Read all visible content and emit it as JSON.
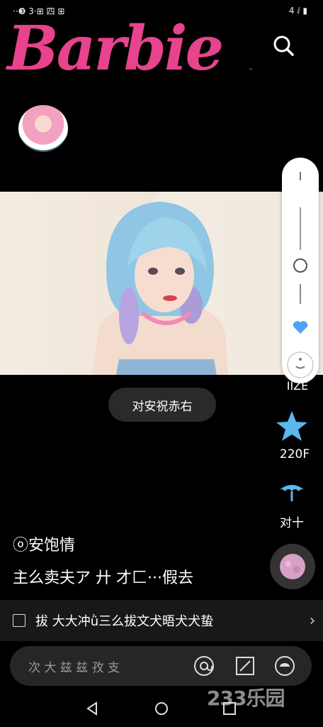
{
  "status_bar": {
    "left": "··❸ 3·⊞ 四 ⊞",
    "right": "4 ⅈ ▮"
  },
  "brand": {
    "logo_text": "Barbie",
    "tm": "™",
    "color": "#e8438d"
  },
  "side_actions": {
    "like_count": "IIZE",
    "star_count": "220F",
    "umbrella_label": "对十"
  },
  "tag_pill": "对安祝赤右",
  "caption": {
    "line1": "ⓞ安饱情",
    "line2": "主么卖夫ア 廾 才匚···假去"
  },
  "hint_bar": {
    "text": "拔 大大冲ǜ三么拔文犬晤犬犬蛰"
  },
  "comment_bar": {
    "placeholder": "次 大 兹 兹 孜 支"
  },
  "watermark": "233乐园",
  "colors": {
    "accent": "#e8438d",
    "heart": "#4fa3f7",
    "star": "#5ab7f0"
  }
}
